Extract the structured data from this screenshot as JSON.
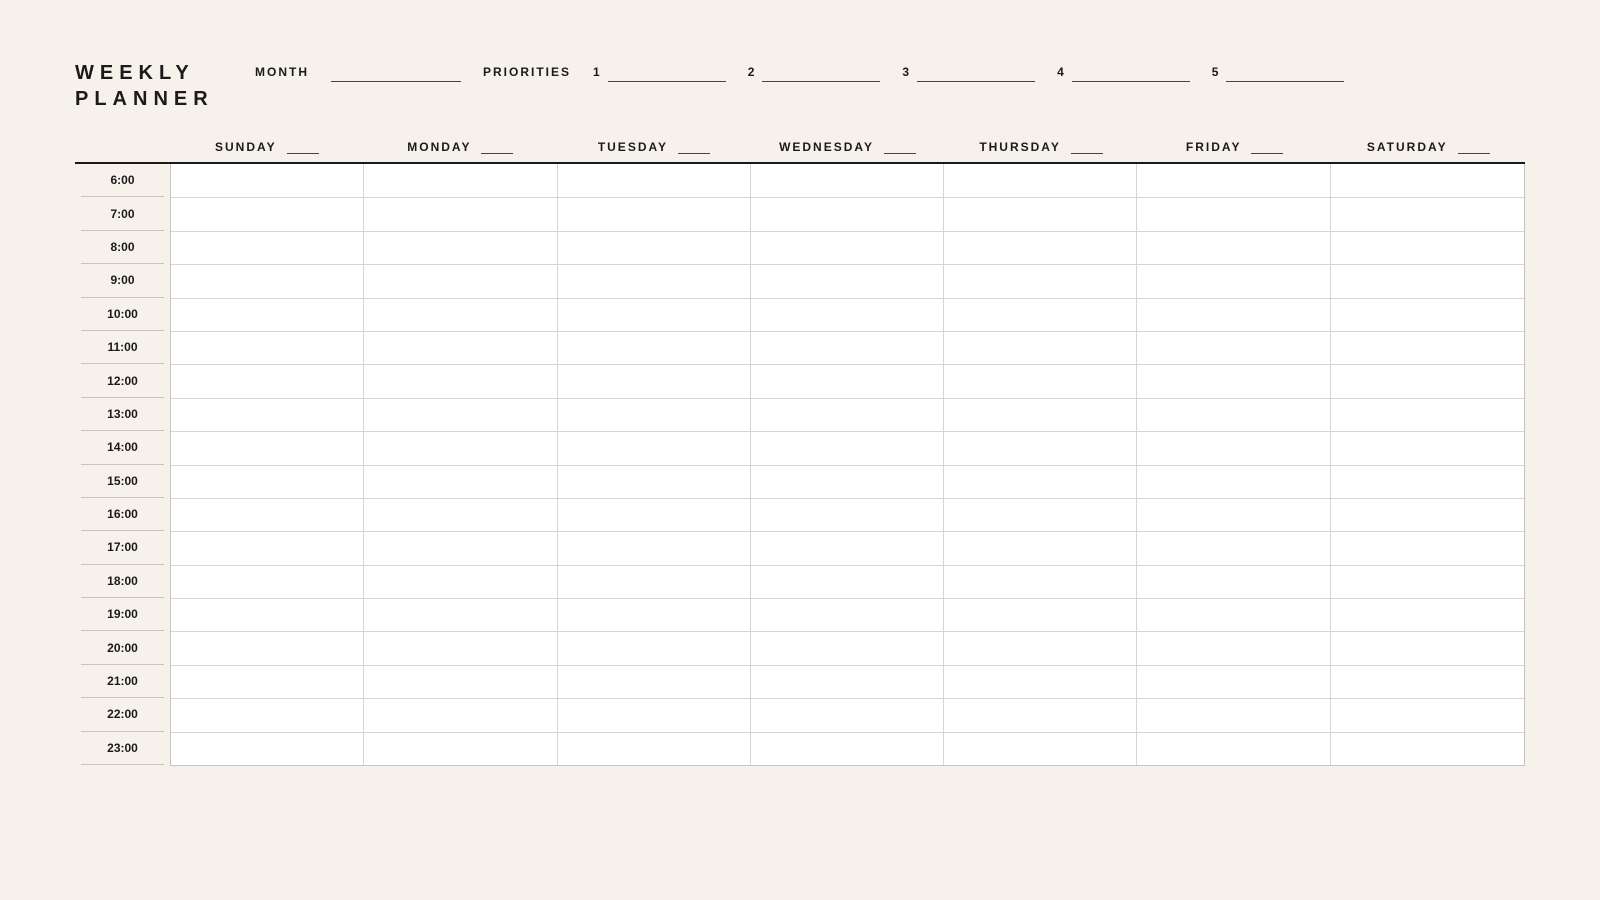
{
  "title_line1": "WEEKLY",
  "title_line2": "PLANNER",
  "month_label": "MONTH",
  "month_value": "",
  "priorities_label": "PRIORITIES",
  "priorities": [
    {
      "num": "1",
      "value": ""
    },
    {
      "num": "2",
      "value": ""
    },
    {
      "num": "3",
      "value": ""
    },
    {
      "num": "4",
      "value": ""
    },
    {
      "num": "5",
      "value": ""
    }
  ],
  "days": [
    {
      "label": "SUNDAY",
      "date": ""
    },
    {
      "label": "MONDAY",
      "date": ""
    },
    {
      "label": "TUESDAY",
      "date": ""
    },
    {
      "label": "WEDNESDAY",
      "date": ""
    },
    {
      "label": "THURSDAY",
      "date": ""
    },
    {
      "label": "FRIDAY",
      "date": ""
    },
    {
      "label": "SATURDAY",
      "date": ""
    }
  ],
  "hours": [
    "6:00",
    "7:00",
    "8:00",
    "9:00",
    "10:00",
    "11:00",
    "12:00",
    "13:00",
    "14:00",
    "15:00",
    "16:00",
    "17:00",
    "18:00",
    "19:00",
    "20:00",
    "21:00",
    "22:00",
    "23:00"
  ]
}
